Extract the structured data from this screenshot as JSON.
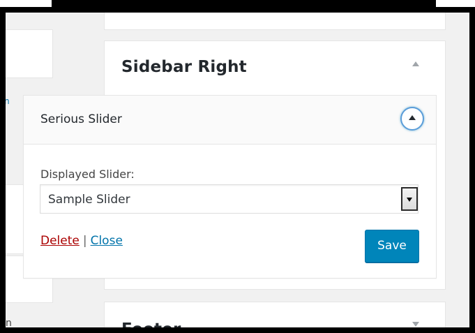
{
  "sidebar_areas": [
    {
      "title": "Sidebar Right",
      "state": "expanded",
      "arrow_icon": "triangle-up-icon"
    },
    {
      "title": "Footer",
      "state": "collapsed",
      "arrow_icon": "triangle-down-icon"
    }
  ],
  "left_fragments": [
    {
      "text": "n"
    },
    {
      "text": "n"
    }
  ],
  "widget": {
    "title": "Serious Slider",
    "toggle_icon": "triangle-up-icon",
    "field_label": "Displayed Slider:",
    "select_value": "Sample Slider",
    "delete_label": "Delete",
    "separator": "|",
    "close_label": "Close",
    "save_label": "Save"
  },
  "colors": {
    "frame": "#000000",
    "background": "#f1f1f1",
    "save_button": "#0085ba",
    "delete_link": "#aa0000",
    "close_link": "#0073aa",
    "toggle_focus_ring": "#5b9dd9"
  }
}
